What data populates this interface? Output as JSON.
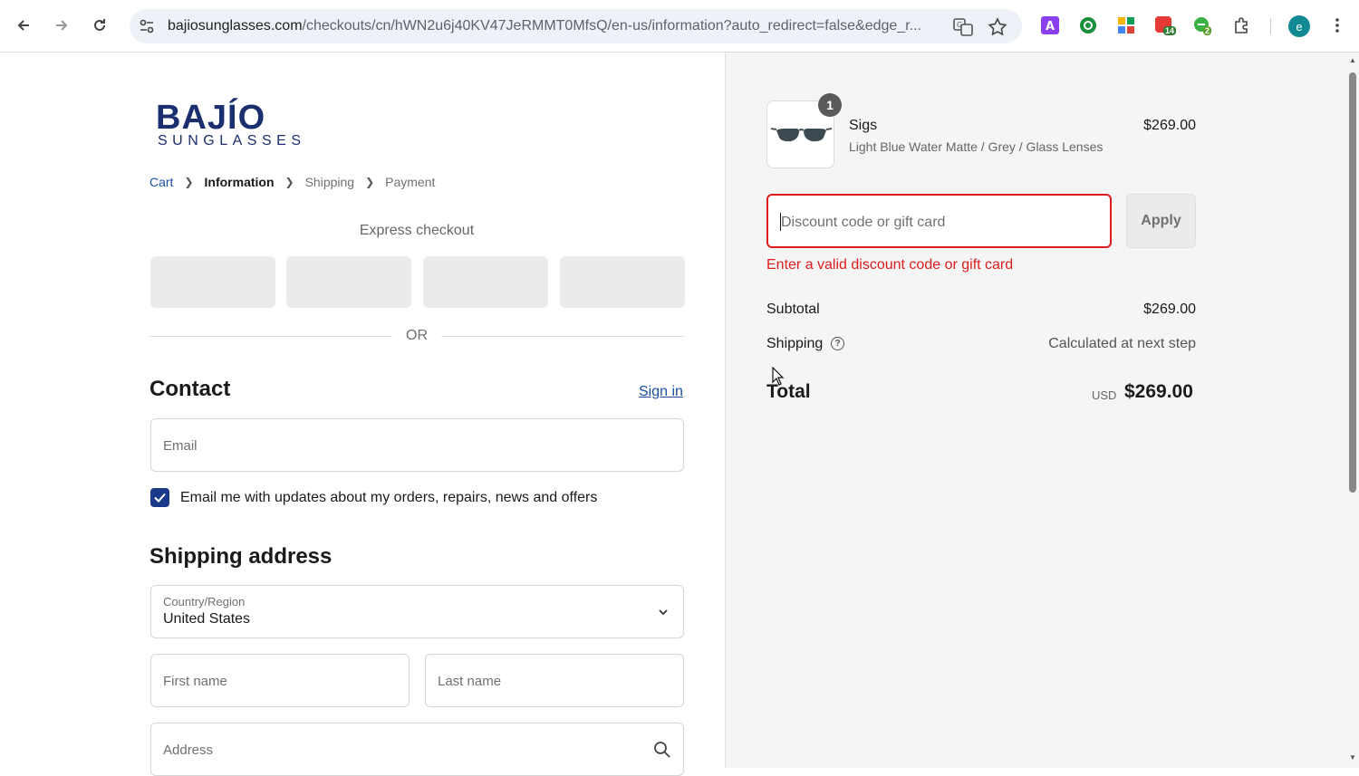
{
  "browser": {
    "url_main": "bajiosunglasses.com",
    "url_rest": "/checkouts/cn/hWN2u6j40KV47JeRMMT0MfsQ/en-us/information?auto_redirect=false&edge_r...",
    "profile_initial": "e",
    "ext_badges": [
      "14",
      "2"
    ]
  },
  "logo": {
    "brand": "BAJÍO",
    "sub": "SUNGLASSES"
  },
  "breadcrumb": {
    "cart": "Cart",
    "information": "Information",
    "shipping": "Shipping",
    "payment": "Payment"
  },
  "express": {
    "label": "Express checkout",
    "or": "OR"
  },
  "contact": {
    "heading": "Contact",
    "signin": "Sign in",
    "email_placeholder": "Email",
    "marketing_label": "Email me with updates about my orders, repairs, news and offers"
  },
  "shipping_address": {
    "heading": "Shipping address",
    "country_label": "Country/Region",
    "country_value": "United States",
    "first_name_placeholder": "First name",
    "last_name_placeholder": "Last name",
    "address_placeholder": "Address"
  },
  "summary": {
    "quantity": "1",
    "product_name": "Sigs",
    "product_variant": "Light Blue Water Matte / Grey / Glass Lenses",
    "product_price": "$269.00",
    "discount_placeholder": "Discount code or gift card",
    "apply_label": "Apply",
    "error": "Enter a valid discount code or gift card",
    "subtotal_label": "Subtotal",
    "subtotal_value": "$269.00",
    "shipping_label": "Shipping",
    "shipping_value": "Calculated at next step",
    "total_label": "Total",
    "total_currency": "USD",
    "total_value": "$269.00"
  },
  "colors": {
    "accent_blue": "#1a4fa0",
    "checkbox": "#1b3a8a",
    "error_red": "#dd1d1d",
    "summary_bg": "#f5f5f5"
  }
}
